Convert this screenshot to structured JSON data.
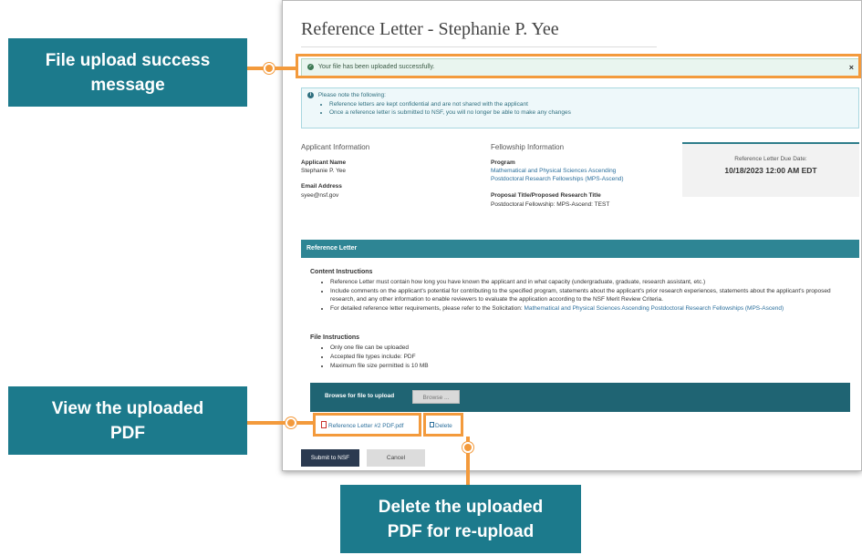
{
  "page": {
    "title": "Reference Letter - Stephanie P. Yee",
    "success_message": "Your file has been uploaded successfully.",
    "close": "×",
    "notice": {
      "title": "Please note the following:",
      "items": [
        "Reference letters are kept confidential and are not shared with the applicant",
        "Once a reference letter is submitted to NSF, you will no longer be able to make any changes"
      ]
    },
    "applicant": {
      "heading": "Applicant Information",
      "name_label": "Applicant Name",
      "name": "Stephanie P. Yee",
      "email_label": "Email Address",
      "email": "syee@nsf.gov"
    },
    "fellowship": {
      "heading": "Fellowship Information",
      "program_label": "Program",
      "program_line1": "Mathematical and Physical Sciences Ascending",
      "program_line2": "Postdoctoral Research Fellowships (MPS-Ascend)",
      "proposal_label": "Proposal Title/Proposed Research Title",
      "proposal": "Postdoctoral Fellowship: MPS-Ascend: TEST"
    },
    "due": {
      "label": "Reference Letter Due Date:",
      "value": "10/18/2023 12:00 AM EDT"
    },
    "section_title": "Reference Letter",
    "content_instructions": {
      "heading": "Content Instructions",
      "item1": "Reference Letter must contain how long you have known the applicant and in what capacity (undergraduate, graduate, research assistant, etc.)",
      "item2": "Include comments on the applicant's potential for contributing to the specified program, statements about the applicant's prior research experiences, statements about the applicant's proposed research, and any other information to enable reviewers to evaluate the application according to the NSF Merit Review Criteria.",
      "item3_prefix": "For detailed reference letter requirements, please refer to the Solicitation: ",
      "item3_link": "Mathematical and Physical Sciences Ascending Postdoctoral Research Fellowships (MPS-Ascend)"
    },
    "file_instructions": {
      "heading": "File Instructions",
      "items": [
        "Only one file can be uploaded",
        "Accepted file types include: PDF",
        "Maximum file size permitted is 10 MB"
      ]
    },
    "browse_label": "Browse for file to upload",
    "browse_button": "Browse ...",
    "file_name": "Reference Letter #2 PDF.pdf",
    "delete_label": "Delete",
    "submit_button": "Submit to NSF",
    "cancel_button": "Cancel"
  },
  "annotations": {
    "success": "File upload success message",
    "view": "View the uploaded PDF",
    "delete": "Delete the uploaded PDF for re-upload"
  },
  "colors": {
    "callout_bg": "#1c7a8c",
    "highlight": "#f39a3c",
    "section_bar": "#2e8594",
    "browse_bar": "#1f6473"
  }
}
